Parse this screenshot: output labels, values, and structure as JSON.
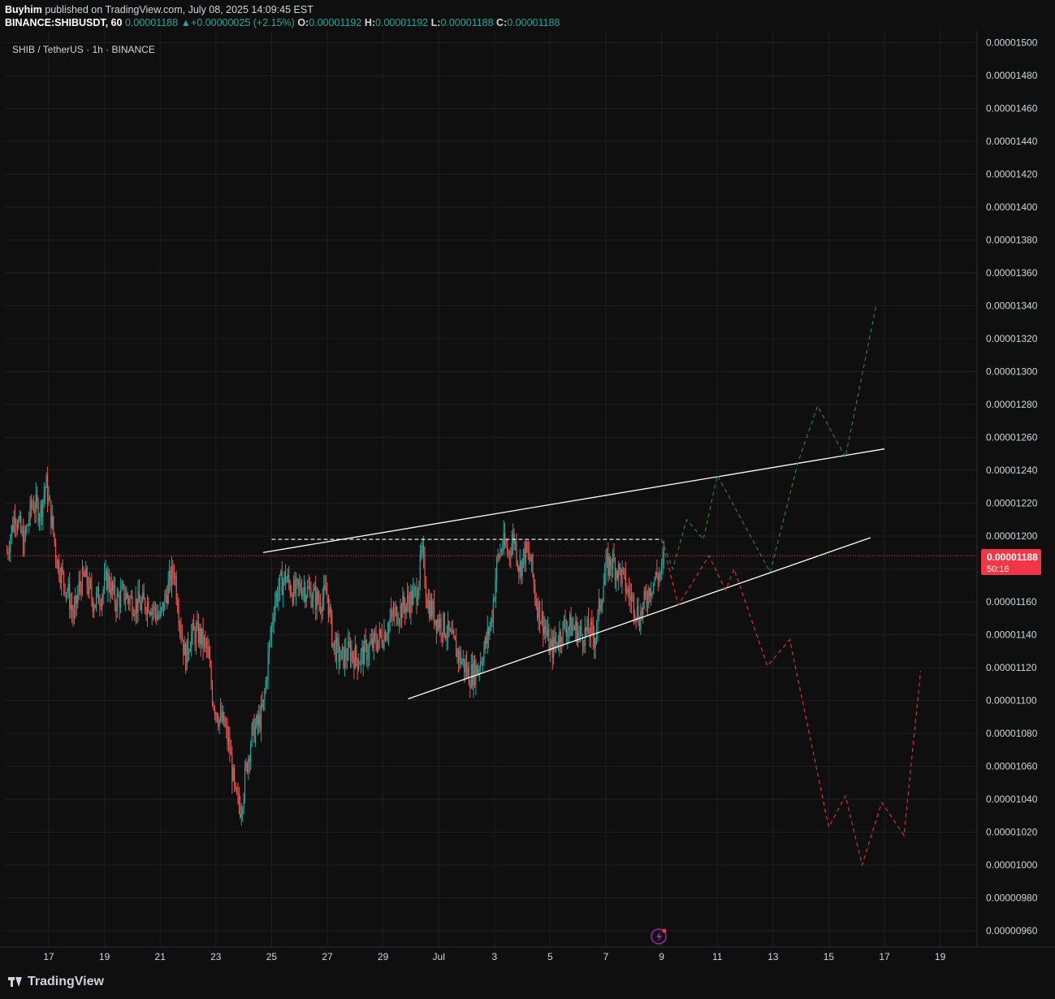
{
  "header": {
    "author": "Buyhim",
    "published": " published on TradingView.com, July 08, 2025 14:09:45 EST",
    "symbol": "BINANCE:SHIBUSDT, 60",
    "last": "0.00001188",
    "arrow": "▲",
    "change": "+0.00000025 (+2.15%)",
    "o_label": "O:",
    "o_value": "0.00001192",
    "h_label": "H:",
    "h_value": "0.00001192",
    "l_label": "L:",
    "l_value": "0.00001188",
    "c_label": "C:",
    "c_value": "0.00001188"
  },
  "footer": {
    "brand": "TradingView"
  },
  "colors": {
    "up": "#26a69a",
    "down": "#ef5350",
    "background": "#0f0f0f",
    "grid": "#1e1f22",
    "price_tag": "#f23645",
    "text": "#d1d4dc"
  },
  "chart_data": {
    "type": "candlestick",
    "title": "SHIB / TetherUS · 1h · BINANCE",
    "y_unit": "USDT",
    "ylim": [
      9.5e-06,
      1.51e-05
    ],
    "y_ticks": [
      "0.00001500",
      "0.00001480",
      "0.00001460",
      "0.00001440",
      "0.00001420",
      "0.00001400",
      "0.00001380",
      "0.00001360",
      "0.00001340",
      "0.00001320",
      "0.00001300",
      "0.00001280",
      "0.00001260",
      "0.00001240",
      "0.00001220",
      "0.00001200",
      "0.00001180",
      "0.00001160",
      "0.00001140",
      "0.00001120",
      "0.00001100",
      "0.00001080",
      "0.00001060",
      "0.00001040",
      "0.00001020",
      "0.00001000",
      "0.00000980",
      "0.00000960"
    ],
    "x_ticks": [
      {
        "label": "17",
        "day": 0
      },
      {
        "label": "19",
        "day": 2
      },
      {
        "label": "21",
        "day": 4
      },
      {
        "label": "23",
        "day": 6
      },
      {
        "label": "25",
        "day": 8
      },
      {
        "label": "27",
        "day": 10
      },
      {
        "label": "29",
        "day": 12
      },
      {
        "label": "Jul",
        "day": 14
      },
      {
        "label": "3",
        "day": 16
      },
      {
        "label": "5",
        "day": 18
      },
      {
        "label": "7",
        "day": 20
      },
      {
        "label": "9",
        "day": 22
      },
      {
        "label": "11",
        "day": 24
      },
      {
        "label": "13",
        "day": 26
      },
      {
        "label": "15",
        "day": 28
      },
      {
        "label": "17",
        "day": 30
      },
      {
        "label": "19",
        "day": 32
      }
    ],
    "xlim_days": [
      -1.5,
      33.5
    ],
    "grid": true,
    "last_price": {
      "value": 1.188e-05,
      "label": "0.00001188",
      "countdown": "50:16"
    },
    "price_path": [
      [
        -1.5,
        1.19e-05
      ],
      [
        -1.2,
        1.215e-05
      ],
      [
        -0.9,
        1.195e-05
      ],
      [
        -0.6,
        1.22e-05
      ],
      [
        -0.3,
        1.215e-05
      ],
      [
        -0.1,
        1.232e-05
      ],
      [
        0.1,
        1.21e-05
      ],
      [
        0.3,
        1.185e-05
      ],
      [
        0.5,
        1.175e-05
      ],
      [
        0.7,
        1.165e-05
      ],
      [
        0.9,
        1.15e-05
      ],
      [
        1.1,
        1.17e-05
      ],
      [
        1.3,
        1.175e-05
      ],
      [
        1.6,
        1.16e-05
      ],
      [
        1.9,
        1.165e-05
      ],
      [
        2.1,
        1.175e-05
      ],
      [
        2.4,
        1.16e-05
      ],
      [
        2.7,
        1.165e-05
      ],
      [
        3.0,
        1.16e-05
      ],
      [
        3.3,
        1.158e-05
      ],
      [
        3.6,
        1.16e-05
      ],
      [
        4.0,
        1.15e-05
      ],
      [
        4.3,
        1.17e-05
      ],
      [
        4.5,
        1.18e-05
      ],
      [
        4.7,
        1.15e-05
      ],
      [
        4.9,
        1.125e-05
      ],
      [
        5.1,
        1.14e-05
      ],
      [
        5.4,
        1.14e-05
      ],
      [
        5.7,
        1.13e-05
      ],
      [
        5.9,
        1.1e-05
      ],
      [
        6.1,
        1.09e-05
      ],
      [
        6.3,
        1.085e-05
      ],
      [
        6.5,
        1.07e-05
      ],
      [
        6.7,
        1.04e-05
      ],
      [
        6.9,
        1.035e-05
      ],
      [
        7.1,
        1.06e-05
      ],
      [
        7.3,
        1.08e-05
      ],
      [
        7.5,
        1.085e-05
      ],
      [
        7.7,
        1.095e-05
      ],
      [
        7.9,
        1.13e-05
      ],
      [
        8.1,
        1.16e-05
      ],
      [
        8.3,
        1.17e-05
      ],
      [
        8.5,
        1.175e-05
      ],
      [
        8.8,
        1.165e-05
      ],
      [
        9.1,
        1.17e-05
      ],
      [
        9.4,
        1.165e-05
      ],
      [
        9.7,
        1.16e-05
      ],
      [
        10.0,
        1.165e-05
      ],
      [
        10.2,
        1.135e-05
      ],
      [
        10.5,
        1.125e-05
      ],
      [
        10.8,
        1.13e-05
      ],
      [
        11.1,
        1.125e-05
      ],
      [
        11.4,
        1.13e-05
      ],
      [
        11.7,
        1.135e-05
      ],
      [
        12.0,
        1.14e-05
      ],
      [
        12.3,
        1.15e-05
      ],
      [
        12.6,
        1.155e-05
      ],
      [
        12.9,
        1.16e-05
      ],
      [
        13.2,
        1.165e-05
      ],
      [
        13.4,
        1.19e-05
      ],
      [
        13.6,
        1.16e-05
      ],
      [
        13.9,
        1.15e-05
      ],
      [
        14.2,
        1.145e-05
      ],
      [
        14.5,
        1.135e-05
      ],
      [
        14.8,
        1.125e-05
      ],
      [
        15.1,
        1.115e-05
      ],
      [
        15.4,
        1.12e-05
      ],
      [
        15.7,
        1.135e-05
      ],
      [
        15.9,
        1.15e-05
      ],
      [
        16.1,
        1.185e-05
      ],
      [
        16.3,
        1.195e-05
      ],
      [
        16.5,
        1.19e-05
      ],
      [
        16.7,
        1.2e-05
      ],
      [
        16.9,
        1.18e-05
      ],
      [
        17.1,
        1.19e-05
      ],
      [
        17.3,
        1.185e-05
      ],
      [
        17.5,
        1.16e-05
      ],
      [
        17.8,
        1.145e-05
      ],
      [
        18.0,
        1.13e-05
      ],
      [
        18.2,
        1.135e-05
      ],
      [
        18.5,
        1.145e-05
      ],
      [
        18.8,
        1.145e-05
      ],
      [
        19.1,
        1.14e-05
      ],
      [
        19.4,
        1.142e-05
      ],
      [
        19.6,
        1.138e-05
      ],
      [
        19.8,
        1.16e-05
      ],
      [
        20.0,
        1.18e-05
      ],
      [
        20.2,
        1.185e-05
      ],
      [
        20.4,
        1.18e-05
      ],
      [
        20.6,
        1.175e-05
      ],
      [
        20.8,
        1.165e-05
      ],
      [
        21.0,
        1.16e-05
      ],
      [
        21.2,
        1.15e-05
      ],
      [
        21.4,
        1.16e-05
      ],
      [
        21.6,
        1.17e-05
      ],
      [
        21.8,
        1.175e-05
      ],
      [
        22.0,
        1.178e-05
      ],
      [
        22.1,
        1.188e-05
      ]
    ],
    "drawings": {
      "upper_trendline": {
        "from": [
          7.7,
          1.19e-05
        ],
        "to": [
          30.0,
          1.253e-05
        ]
      },
      "lower_trendline": {
        "from": [
          12.9,
          1.101e-05
        ],
        "to": [
          29.5,
          1.199e-05
        ]
      },
      "resistance_dashed": {
        "from": [
          8.0,
          1.198e-05
        ],
        "to": [
          22.0,
          1.198e-05
        ]
      },
      "bullish_projection": [
        [
          22.0,
          1.198e-05
        ],
        [
          22.4,
          1.18e-05
        ],
        [
          22.9,
          1.21e-05
        ],
        [
          23.5,
          1.198e-05
        ],
        [
          24.0,
          1.237e-05
        ],
        [
          25.9,
          1.178e-05
        ],
        [
          26.9,
          1.245e-05
        ],
        [
          27.6,
          1.279e-05
        ],
        [
          28.6,
          1.248e-05
        ],
        [
          29.7,
          1.34e-05
        ]
      ],
      "bearish_projection": [
        [
          22.0,
          1.198e-05
        ],
        [
          22.6,
          1.158e-05
        ],
        [
          23.7,
          1.188e-05
        ],
        [
          24.3,
          1.167e-05
        ],
        [
          24.6,
          1.18e-05
        ],
        [
          25.8,
          1.121e-05
        ],
        [
          26.6,
          1.137e-05
        ],
        [
          28.0,
          1.023e-05
        ],
        [
          28.6,
          1.042e-05
        ],
        [
          29.2,
          1e-05
        ],
        [
          29.9,
          1.038e-05
        ],
        [
          30.7,
          1.018e-05
        ],
        [
          31.3,
          1.118e-05
        ]
      ]
    }
  }
}
